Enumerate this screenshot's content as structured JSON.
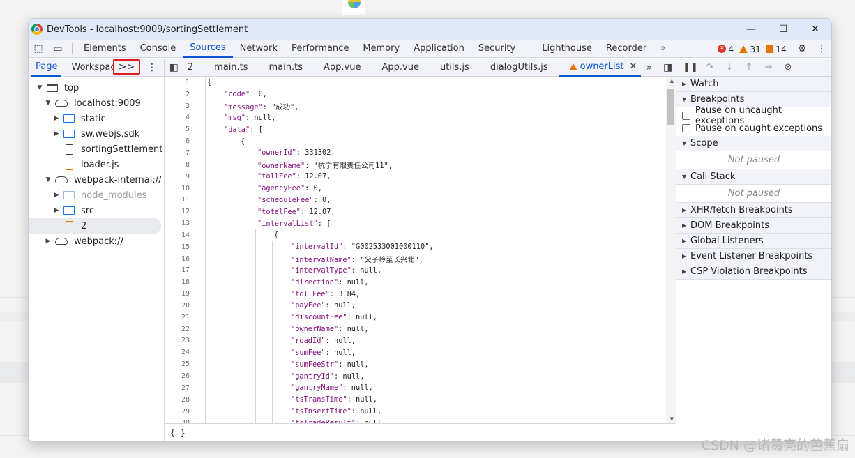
{
  "window": {
    "title": "DevTools - localhost:9009/sortingSettlement",
    "controls": {
      "minimize": "—",
      "maximize": "☐",
      "close": "✕"
    }
  },
  "main_tabs": [
    "Elements",
    "Console",
    "Sources",
    "Network",
    "Performance",
    "Memory",
    "Application",
    "Security",
    "Lighthouse",
    "Recorder"
  ],
  "main_tabs_active": "Sources",
  "more_tabs": "»",
  "counters": {
    "errors": "4",
    "warnings": "31",
    "issues": "14"
  },
  "navigator": {
    "tabs": [
      "Page",
      "Workspace"
    ],
    "more": ">>",
    "tree": [
      {
        "label": "top",
        "icon": "frame-icon"
      },
      {
        "label": "localhost:9009",
        "icon": "cloud-icon"
      },
      {
        "label": "static",
        "icon": "folder-icon"
      },
      {
        "label": "sw.webjs.sdk",
        "icon": "folder-icon"
      },
      {
        "label": "sortingSettlement",
        "icon": "file-icon"
      },
      {
        "label": "loader.js",
        "icon": "file-icon"
      },
      {
        "label": "webpack-internal://",
        "icon": "cloud-icon"
      },
      {
        "label": "node_modules",
        "icon": "folder-icon"
      },
      {
        "label": "src",
        "icon": "folder-icon"
      },
      {
        "label": "2",
        "icon": "file-icon"
      },
      {
        "label": "webpack://",
        "icon": "cloud-icon"
      }
    ]
  },
  "editor": {
    "tabs": [
      "2",
      "main.ts",
      "main.ts",
      "App.vue",
      "App.vue",
      "utils.js",
      "dialogUtils.js",
      "ownerList"
    ],
    "active_tab": "ownerList",
    "status": "{ }",
    "lines": [
      "{",
      "\"code\": 0,",
      "\"message\": \"成功\",",
      "\"msg\": null,",
      "\"data\": [",
      "{",
      "\"ownerId\": 331302,",
      "\"ownerName\": \"杭宁有限责任公司11\",",
      "\"tollFee\": 12.07,",
      "\"agencyFee\": 0,",
      "\"scheduleFee\": 0,",
      "\"totalFee\": 12.07,",
      "\"intervalList\": [",
      "{",
      "\"intervalId\": \"G002533001000110\",",
      "\"intervalName\": \"父子岭至长兴北\",",
      "\"intervalType\": null,",
      "\"direction\": null,",
      "\"tollFee\": 3.84,",
      "\"payFee\": null,",
      "\"discountFee\": null,",
      "\"ownerName\": null,",
      "\"roadId\": null,",
      "\"sumFee\": null,",
      "\"sumFeeStr\": null,",
      "\"gantryId\": null,",
      "\"gantryName\": null,",
      "\"tsTransTime\": null,",
      "\"tsInsertTime\": null,",
      "\"tsTradeResult\": null,"
    ]
  },
  "debugger": {
    "sections": {
      "watch": "Watch",
      "breakpoints": "Breakpoints",
      "pause_uncaught": "Pause on uncaught exceptions",
      "pause_caught": "Pause on caught exceptions",
      "scope": "Scope",
      "not_paused": "Not paused",
      "call_stack": "Call Stack",
      "xhr": "XHR/fetch Breakpoints",
      "dom": "DOM Breakpoints",
      "global": "Global Listeners",
      "event": "Event Listener Breakpoints",
      "csp": "CSP Violation Breakpoints"
    }
  },
  "watermark": "CSDN @诸葛亮的芭蕉扇"
}
